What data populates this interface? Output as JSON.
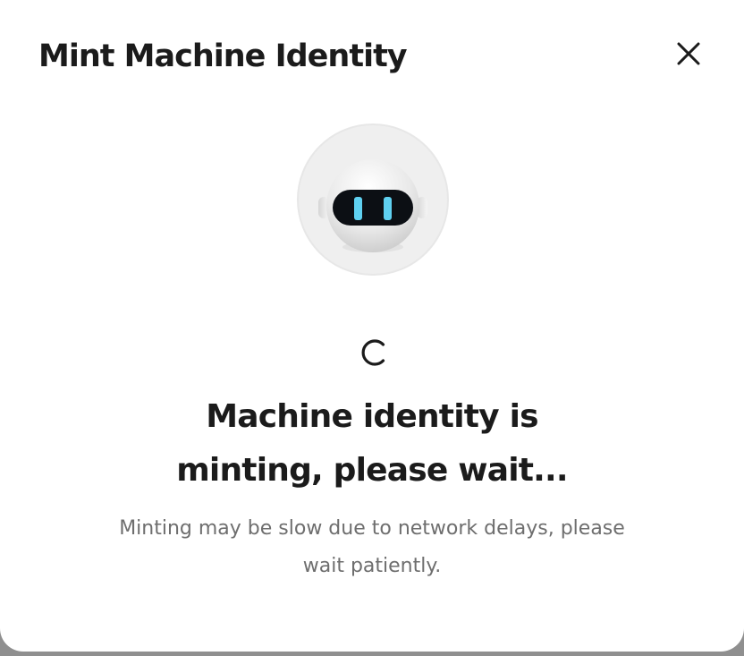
{
  "modal": {
    "title": "Mint Machine Identity",
    "close_icon": "close-icon",
    "avatar_icon": "robot-avatar-icon",
    "spinner_icon": "loading-spinner-icon",
    "status_line1": "Machine identity is",
    "status_line2": "minting, please wait...",
    "note_line1": "Minting may be slow due to network delays, please",
    "note_line2": "wait patiently."
  },
  "colors": {
    "text_primary": "#1b1b1b",
    "text_secondary": "#6e6e6e",
    "eye_glow": "#5fd0f0",
    "visor": "#0c0f14",
    "backdrop": "#8f8f8f"
  }
}
